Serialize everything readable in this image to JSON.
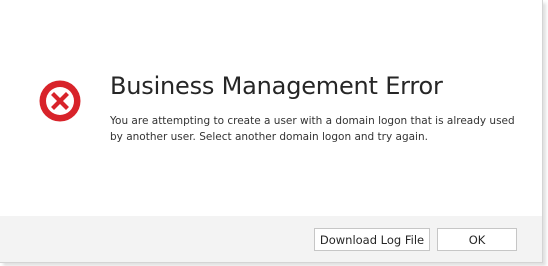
{
  "dialog": {
    "title": "Business Management Error",
    "message": "You are attempting to create a user with a domain logon that is already used by another user. Select another domain logon and try again.",
    "icon": "error-icon",
    "icon_color": "#d8232a"
  },
  "footer": {
    "download_log_label": "Download Log File",
    "ok_label": "OK"
  }
}
